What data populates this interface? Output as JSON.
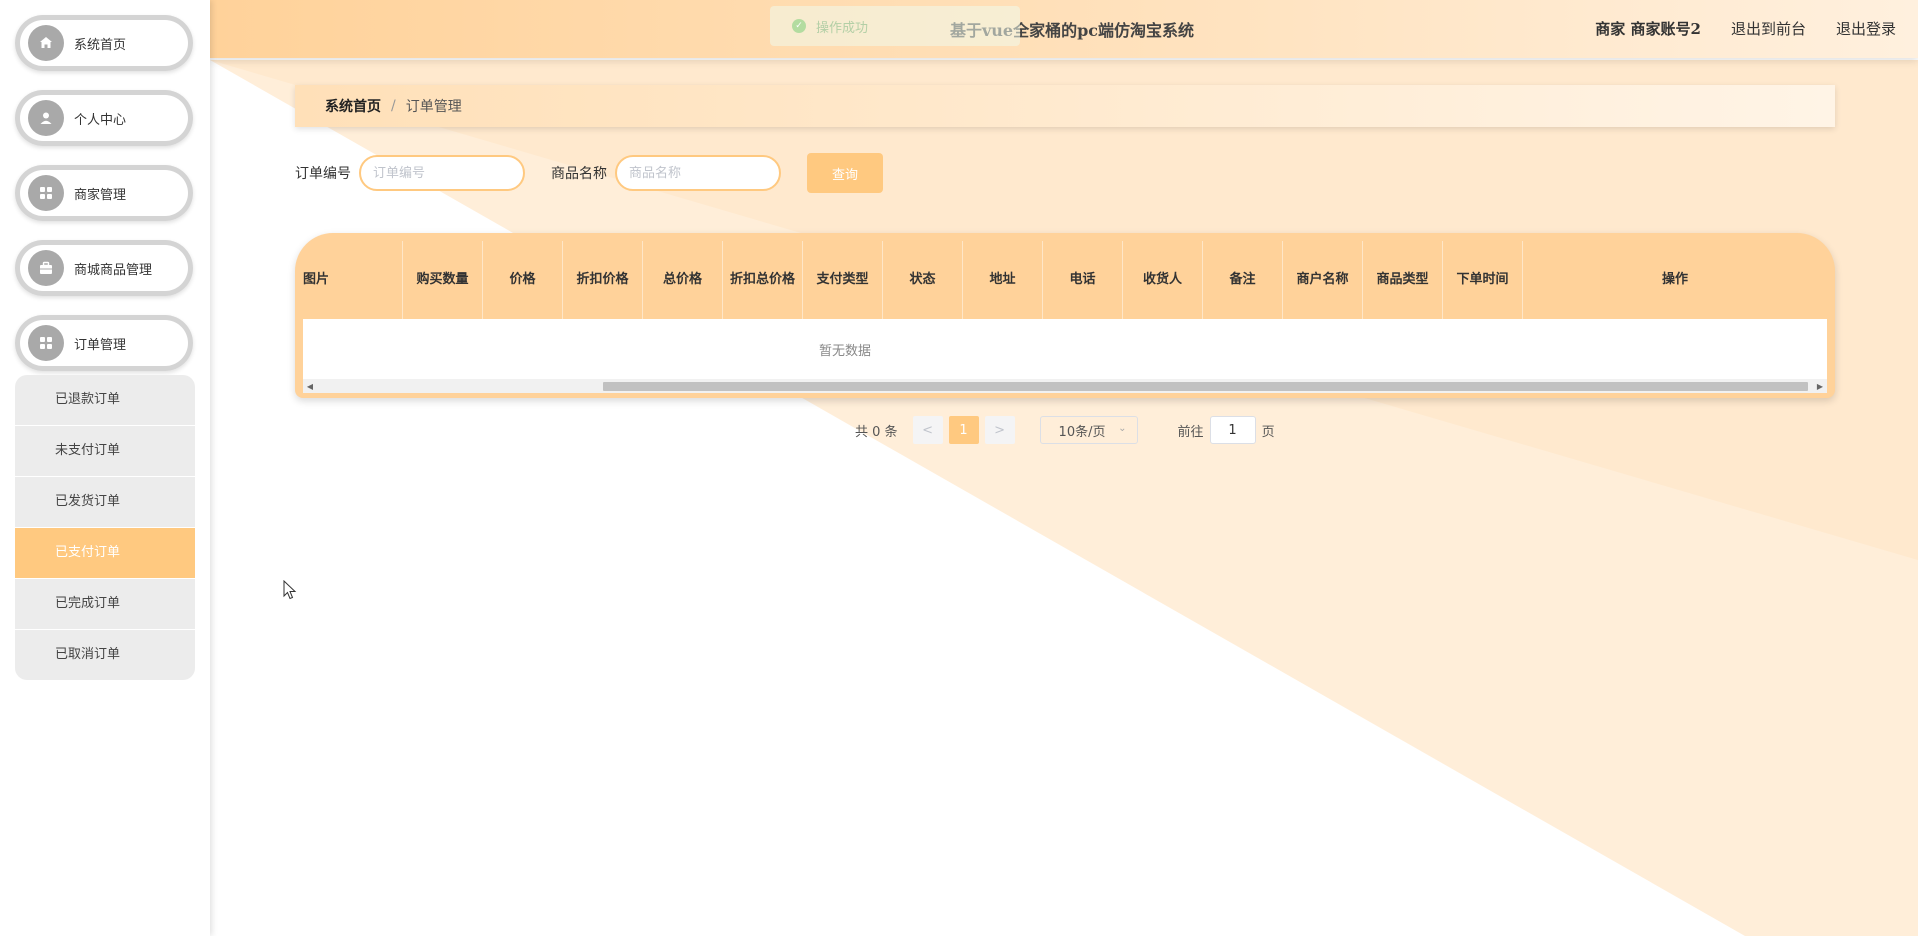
{
  "header": {
    "title": "基于vue全家桶的pc端仿淘宝系统",
    "user": "商家 商家账号2",
    "back_front": "退出到前台",
    "logout": "退出登录"
  },
  "toast": {
    "text": "操作成功"
  },
  "sidebar": {
    "items": [
      {
        "label": "系统首页",
        "icon": "home-icon"
      },
      {
        "label": "个人中心",
        "icon": "user-icon"
      },
      {
        "label": "商家管理",
        "icon": "grid-icon"
      },
      {
        "label": "商城商品管理",
        "icon": "briefcase-icon"
      },
      {
        "label": "订单管理",
        "icon": "grid-icon"
      }
    ],
    "submenu": [
      "已退款订单",
      "未支付订单",
      "已发货订单",
      "已支付订单",
      "已完成订单",
      "已取消订单"
    ],
    "active_sub": "已支付订单"
  },
  "breadcrumb": {
    "home": "系统首页",
    "sep": "/",
    "current": "订单管理"
  },
  "search": {
    "order_no_label": "订单编号",
    "order_no_placeholder": "订单编号",
    "product_label": "商品名称",
    "product_placeholder": "商品名称",
    "query_label": "查询"
  },
  "table": {
    "columns": [
      "图片",
      "购买数量",
      "价格",
      "折扣价格",
      "总价格",
      "折扣总价格",
      "支付类型",
      "状态",
      "地址",
      "电话",
      "收货人",
      "备注",
      "商户名称",
      "商品类型",
      "下单时间",
      "操作"
    ],
    "empty_text": "暂无数据"
  },
  "pager": {
    "total": "共 0 条",
    "prev": "<",
    "page": "1",
    "next": ">",
    "size": "10条/页",
    "goto": "前往",
    "goto_value": "1",
    "page_unit": "页"
  },
  "colors": {
    "accent": "#ffc980",
    "header": "#ffd29a"
  }
}
